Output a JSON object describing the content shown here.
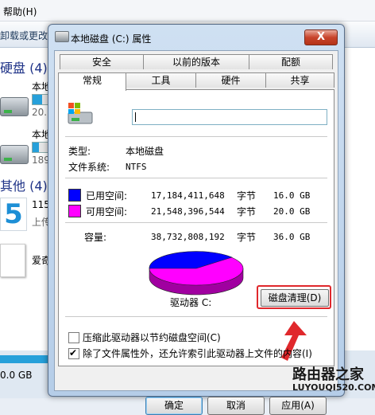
{
  "background": {
    "menu_help": "帮助(H)",
    "toolbar_text": "卸载或更改程",
    "section_hdd": "硬盘 (4)",
    "drive1_name": "本地",
    "drive1_sub": "20.",
    "drive2_name": "本地",
    "drive2_sub": "189",
    "section_other": "其他 (4)",
    "item1_name": "115",
    "item1_sub": "上传",
    "item2_name": "爱奇",
    "bottom_size": "0.0 GB"
  },
  "dialog": {
    "title": "本地磁盘 (C:) 属性",
    "close_label": "X",
    "tabs_back": [
      "安全",
      "以前的版本",
      "配额"
    ],
    "tabs_front": [
      "常规",
      "工具",
      "硬件",
      "共享"
    ],
    "name_value": "",
    "type_label": "类型:",
    "type_value": "本地磁盘",
    "fs_label": "文件系统:",
    "fs_value": "NTFS",
    "used_label": "已用空间:",
    "used_bytes": "17,184,411,648",
    "used_unit": "字节",
    "used_gb": "16.0 GB",
    "free_label": "可用空间:",
    "free_bytes": "21,548,396,544",
    "free_unit": "字节",
    "free_gb": "20.0 GB",
    "cap_label": "容量:",
    "cap_bytes": "38,732,808,192",
    "cap_unit": "字节",
    "cap_gb": "36.0 GB",
    "drive_label": "驱动器 C:",
    "cleanup_button": "磁盘清理(D)",
    "compress_label": "压缩此驱动器以节约磁盘空间(C)",
    "compress_checked": false,
    "index_label": "除了文件属性外，还允许索引此驱动器上文件的内容(I)",
    "index_checked": true,
    "ok_button": "确定",
    "cancel_button": "取消",
    "apply_button": "应用(A)",
    "colors": {
      "used": "#0000ff",
      "free": "#ff00ff",
      "highlight": "#e0282c"
    }
  },
  "watermark": {
    "brand": "路由器之家",
    "url": "LUYOUQI520.COM"
  }
}
